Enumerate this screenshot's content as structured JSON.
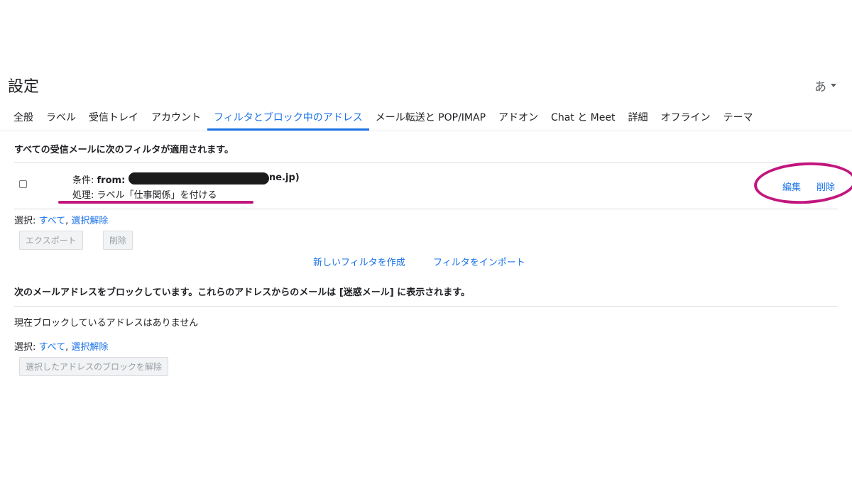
{
  "page_title": "設定",
  "input_tool": {
    "label": "あ"
  },
  "tabs": [
    {
      "label": "全般"
    },
    {
      "label": "ラベル"
    },
    {
      "label": "受信トレイ"
    },
    {
      "label": "アカウント"
    },
    {
      "label": "フィルタとブロック中のアドレス",
      "active": true
    },
    {
      "label": "メール転送と POP/IMAP"
    },
    {
      "label": "アドオン"
    },
    {
      "label": "Chat と Meet"
    },
    {
      "label": "詳細"
    },
    {
      "label": "オフライン"
    },
    {
      "label": "テーマ"
    }
  ],
  "filters": {
    "heading": "すべての受信メールに次のフィルタが適用されます。",
    "item": {
      "condition_label": "条件:",
      "condition_from": "from:",
      "condition_suffix": "ne.jp)",
      "action": "処理: ラベル「仕事関係」を付ける",
      "edit_label": "編集",
      "delete_label": "削除"
    },
    "select": {
      "label": "選択:",
      "all": "すべて",
      "separator": ",",
      "none": "選択解除"
    },
    "export_button": "エクスポート",
    "delete_button": "削除",
    "create_link": "新しいフィルタを作成",
    "import_link": "フィルタをインポート"
  },
  "blocked": {
    "heading": "次のメールアドレスをブロックしています。これらのアドレスからのメールは [迷惑メール] に表示されます。",
    "empty_text": "現在ブロックしているアドレスはありません",
    "select": {
      "label": "選択:",
      "all": "すべて",
      "separator": ",",
      "none": "選択解除"
    },
    "unblock_button": "選択したアドレスのブロックを解除"
  },
  "colors": {
    "accent": "#1a73e8",
    "annotation": "#c2167e"
  }
}
